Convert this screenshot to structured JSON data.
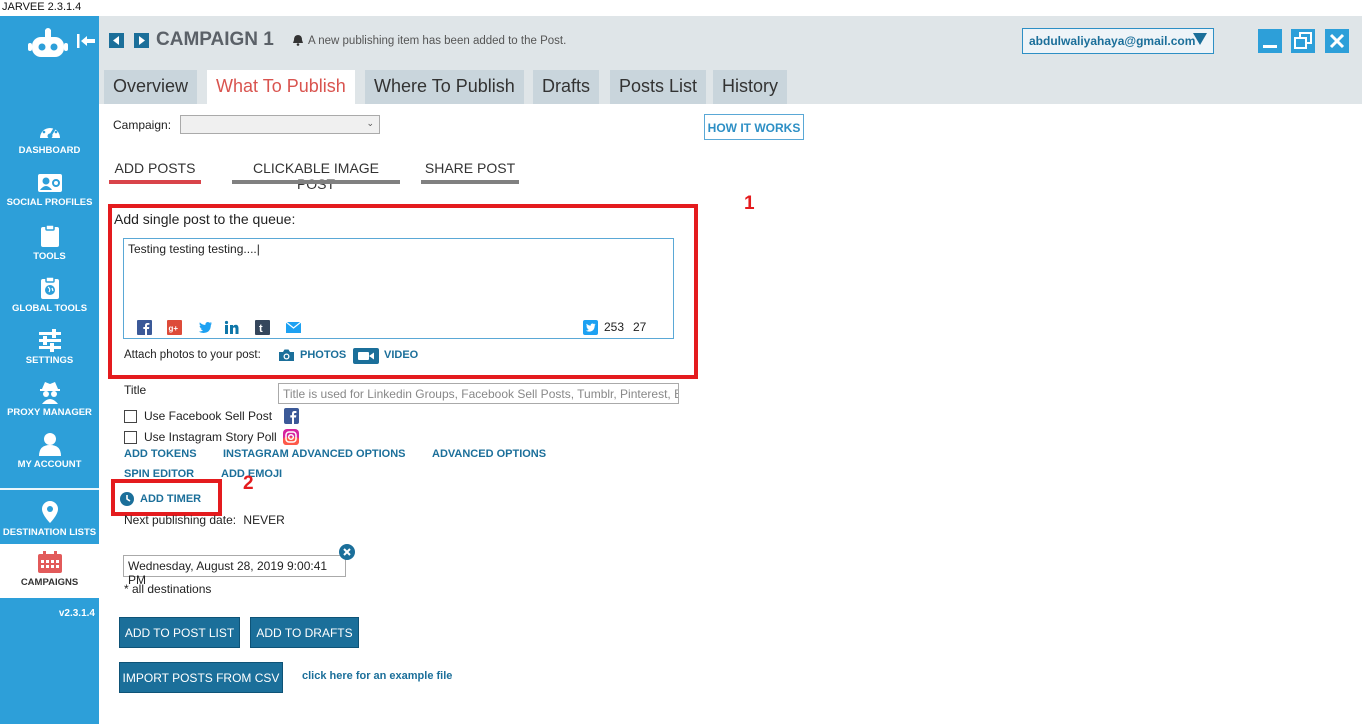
{
  "app": {
    "title": "JARVEE 2.3.1.4",
    "version": "v2.3.1.4"
  },
  "sidebar": {
    "items": [
      {
        "label": "DASHBOARD",
        "icon": "dashboard-icon"
      },
      {
        "label": "SOCIAL PROFILES",
        "icon": "social-profiles-icon"
      },
      {
        "label": "TOOLS",
        "icon": "clipboard-icon"
      },
      {
        "label": "GLOBAL TOOLS",
        "icon": "globe-clipboard-icon"
      },
      {
        "label": "SETTINGS",
        "icon": "sliders-icon"
      },
      {
        "label": "PROXY MANAGER",
        "icon": "spy-icon"
      },
      {
        "label": "MY ACCOUNT",
        "icon": "user-icon"
      },
      {
        "label": "DESTINATION LISTS",
        "icon": "map-pin-icon"
      },
      {
        "label": "CAMPAIGNS",
        "icon": "calendar-icon",
        "active": true
      }
    ]
  },
  "header": {
    "campaign_title": "CAMPAIGN 1",
    "notice": "A new publishing item has been added to the Post.",
    "account": "abdulwaliyahaya@gmail.com"
  },
  "tabs": [
    {
      "label": "Overview"
    },
    {
      "label": "What To Publish",
      "active": true
    },
    {
      "label": "Where To Publish"
    },
    {
      "label": "Drafts"
    },
    {
      "label": "Posts List"
    },
    {
      "label": "History"
    }
  ],
  "form": {
    "campaign_label": "Campaign:",
    "campaign_value": "",
    "how_it_works": "HOW IT WORKS",
    "subtabs": [
      {
        "label": "ADD POSTS",
        "active": true
      },
      {
        "label": "CLICKABLE IMAGE POST"
      },
      {
        "label": "SHARE POST"
      }
    ],
    "queue_title": "Add single post to the queue:",
    "post_text": "Testing testing testing....|",
    "twitter_count": "253",
    "char_count": "27",
    "attach_label": "Attach photos to your post:",
    "photos_label": "PHOTOS",
    "video_label": "VIDEO",
    "title_label": "Title",
    "title_placeholder": "Title is used for Linkedin Groups, Facebook Sell Posts, Tumblr, Pinterest, Em",
    "fb_sell_label": "Use Facebook Sell Post",
    "ig_poll_label": "Use Instagram Story Poll",
    "add_tokens": "ADD TOKENS",
    "instagram_advanced": "INSTAGRAM ADVANCED OPTIONS",
    "advanced_options": "ADVANCED OPTIONS",
    "spin_editor": "SPIN EDITOR",
    "add_emoji": "ADD EMOJI",
    "add_timer": "ADD TIMER",
    "next_publishing_label": "Next publishing date:",
    "next_publishing_value": "NEVER",
    "date_value": "Wednesday, August 28, 2019 9:00:41 PM",
    "all_destinations": "* all destinations",
    "add_to_post_list": "ADD TO POST LIST",
    "add_to_drafts": "ADD TO DRAFTS",
    "import_csv": "IMPORT POSTS FROM CSV",
    "example_file": "click here for an example file"
  },
  "annotations": {
    "box1": "1",
    "box2": "2"
  },
  "colors": {
    "sidebar": "#2d9fd9",
    "primary_button": "#1b6f9a",
    "active_tab_text": "#d9544f",
    "annotation_red": "#e41b1e"
  }
}
